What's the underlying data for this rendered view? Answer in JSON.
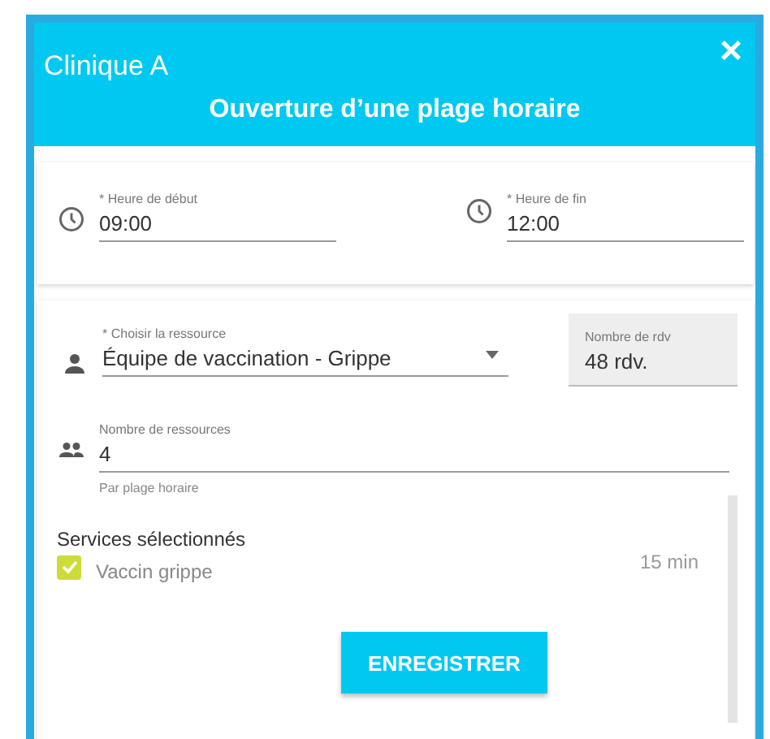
{
  "window": {
    "title": "Clinique A",
    "subtitle": "Ouverture d’une plage horaire",
    "close": "×"
  },
  "time_fields": [
    {
      "label": "* Heure de début",
      "value": "09:00"
    },
    {
      "label": "* Heure de fin",
      "value": "12:00"
    }
  ],
  "resource": {
    "label": "* Choisir la ressource",
    "value": "Équipe de vaccination - Grippe"
  },
  "appointments": {
    "label": "Nombre de rdv",
    "value": "48 rdv."
  },
  "resource_count": {
    "label": "Nombre de ressources",
    "value": "4",
    "helper": "Par plage horaire"
  },
  "services": {
    "title": "Services sélectionnés",
    "items": [
      {
        "name": "Vaccin grippe",
        "duration": "15 min",
        "checked": true
      }
    ]
  },
  "save_button": "ENREGISTRER"
}
